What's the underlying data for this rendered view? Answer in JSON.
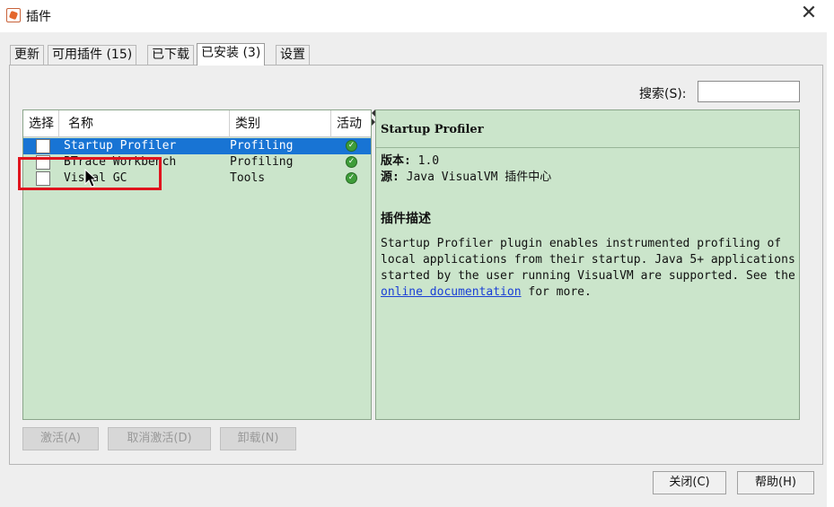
{
  "window": {
    "title": "插件",
    "close_glyph": "✕"
  },
  "tabs": [
    {
      "label": "更新"
    },
    {
      "label": "可用插件 (15)"
    },
    {
      "label": "已下载"
    },
    {
      "label": "已安装 (3)"
    },
    {
      "label": "设置"
    }
  ],
  "search": {
    "label": "搜索(S):",
    "value": ""
  },
  "table": {
    "headers": [
      "选择",
      "名称",
      "类别",
      "活动"
    ],
    "rows": [
      {
        "name": "Startup Profiler",
        "category": "Profiling",
        "checked": false,
        "active": true,
        "selected": true
      },
      {
        "name": "BTrace Workbench",
        "category": "Profiling",
        "checked": false,
        "active": true,
        "selected": false
      },
      {
        "name": "Visual GC",
        "category": "Tools",
        "checked": false,
        "active": true,
        "selected": false
      }
    ]
  },
  "detail": {
    "title": "Startup Profiler",
    "version_label": "版本:",
    "version_value": "1.0",
    "source_label": "源:",
    "source_value": "Java VisualVM 插件中心",
    "desc_heading": "插件描述",
    "desc_text": "Startup Profiler plugin enables instrumented profiling of local applications from their startup. Java 5+ applications started by the user running VisualVM are supported. See the",
    "desc_link": "online documentation",
    "desc_tail": "for more."
  },
  "actions": {
    "activate": "激活(A)",
    "deactivate": "取消激活(D)",
    "uninstall": "卸载(N)"
  },
  "footer": {
    "close": "关闭(C)",
    "help": "帮助(H)"
  },
  "colors": {
    "panel_green": "#cbe5cb",
    "selection_blue": "#1874d4",
    "annotation_red": "#e0141e",
    "link_blue": "#1a3fd6"
  }
}
